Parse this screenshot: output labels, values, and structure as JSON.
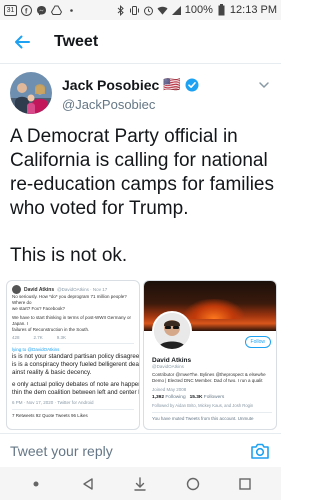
{
  "status_bar": {
    "left_icons": [
      "calendar-icon",
      "facebook-icon",
      "messenger-icon",
      "drive-icon",
      "more-dots-icon"
    ],
    "calendar_day": "31",
    "right_icons": [
      "bluetooth-icon",
      "vibrate-icon",
      "alarm-icon",
      "wifi-icon",
      "signal-icon"
    ],
    "battery": "100%",
    "time": "12:13 PM"
  },
  "app_bar": {
    "title": "Tweet"
  },
  "author": {
    "name": "Jack Posobiec",
    "flag": "🇺🇸",
    "handle": "@JackPosobiec"
  },
  "tweet": {
    "text": "A Democrat Party official in California is calling for national re-education camps for families who voted for Trump.",
    "text2": "This is not ok."
  },
  "media_left": {
    "name": "David Atkins",
    "handle": "@DavidOAtkins · Nov 17",
    "line1": "No seriously. How *do* you deprogram 71 million people? Where do",
    "line2": "we start? Fox? Facebook?",
    "line3": "We have to start thinking in terms of post-WWII Germany or Japan. I",
    "line4": "failures of Reconstruction in the South.",
    "actions": [
      "428",
      "2.7K",
      "9.3K"
    ],
    "reply_to": "lying to @DavidOAtkins",
    "big1": "is is not your standard partisan policy disagreem",
    "big2": "is is a conspiracy theory fueled belligerent death",
    "big3": "ainst reality & basic decency.",
    "big4": "e only actual policy debates of note are happenin",
    "big5": "thin the dem coalition between left and center le",
    "meta": "6 PM · Nov 17, 2020 · Twitter for Android",
    "stats": "7 Retweets   92 Quote Tweets   96 Likes"
  },
  "media_right": {
    "name": "David Atkins",
    "handle": "@DavidOAtkins",
    "follow": "Follow",
    "bio1": "Contributor @mweThe. Bylines @theprospect & elsewhe",
    "bio2": "Demo | Elected DNC Member. Dad of two. I run a qualit",
    "joined": "Joined May 2008",
    "following": "1,392",
    "following_label": "Following",
    "followers": "15.3K",
    "followers_label": "Followers",
    "followed_by": "Followed by Aidan Brito, Mickey Kaus, and Josh Rogin",
    "muted": "You have muted Tweets from this account. Unmute"
  },
  "reply": {
    "placeholder": "Tweet your reply"
  },
  "colors": {
    "accent": "#1da1f2",
    "text": "#14171a",
    "muted": "#657786"
  }
}
